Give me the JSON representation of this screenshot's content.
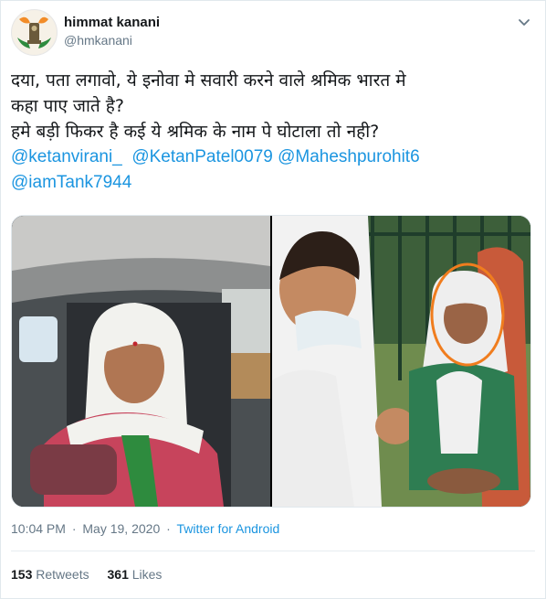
{
  "user": {
    "display_name": "himmat kanani",
    "handle": "@hmkanani",
    "avatar_icon": "emblem-avatar-icon"
  },
  "tweet": {
    "line1": "दया, पता लगावो, ये इनोवा मे सवारी करने वाले श्रमिक भारत मे",
    "line2": "कहा पाए जाते है?",
    "line3": "हमे बड़ी फिकर है कई ये श्रमिक के नाम पे घोटाला तो नही?",
    "mentions": [
      "@ketanvirani_",
      "@KetanPatel0079",
      "@Maheshpurohit6",
      "@iamTank7944"
    ]
  },
  "meta": {
    "time": "10:04 PM",
    "separator": "·",
    "date": "May 19, 2020",
    "source": "Twitter for Android"
  },
  "stats": {
    "retweets_count": "153",
    "retweets_label": "Retweets",
    "likes_count": "361",
    "likes_label": "Likes"
  },
  "colors": {
    "link": "#1b95e0",
    "highlight_circle": "#f07d1e"
  }
}
